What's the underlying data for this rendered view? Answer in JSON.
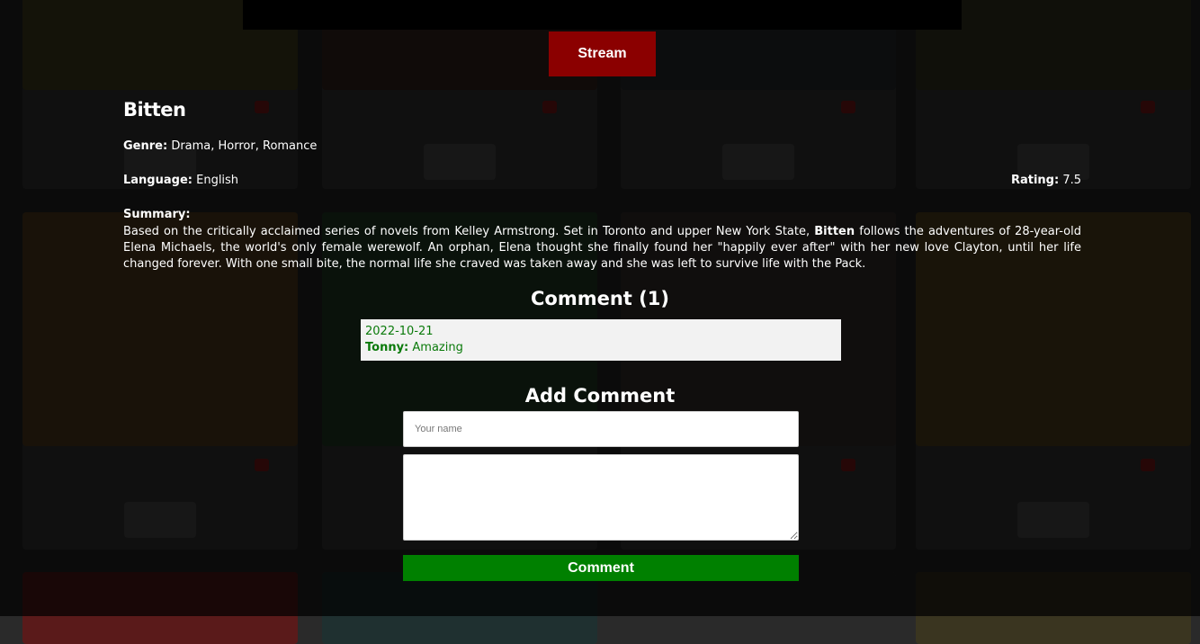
{
  "player": {},
  "stream_button": "Stream",
  "show": {
    "title": "Bitten",
    "genre_label": "Genre:",
    "genre": "Drama, Horror, Romance",
    "language_label": "Language:",
    "language": "English",
    "rating_label": "Rating:",
    "rating": "7.5",
    "summary_label": "Summary:",
    "summary_before": "Based on the critically acclaimed series of novels from Kelley Armstrong. Set in Toronto and upper New York State, ",
    "summary_bold": "Bitten",
    "summary_after": " follows the adventures of 28-year-old Elena Michaels, the world's only female werewolf. An orphan, Elena thought she finally found her \"happily ever after\" with her new love Clayton, until her life changed forever. With one small bite, the normal life she craved was taken away and she was left to survive life with the Pack."
  },
  "comments": {
    "title": "Comment (1)",
    "items": [
      {
        "date": "2022-10-21",
        "author": "Tonny:",
        "text": "Amazing"
      }
    ]
  },
  "add_comment": {
    "title": "Add Comment",
    "name_placeholder": "Your name",
    "name_value": "",
    "comment_value": "",
    "submit_label": "Comment"
  },
  "colors": {
    "stream_button": "#8b0000",
    "comment_button": "#008000",
    "comment_text": "#0a7a0a"
  }
}
